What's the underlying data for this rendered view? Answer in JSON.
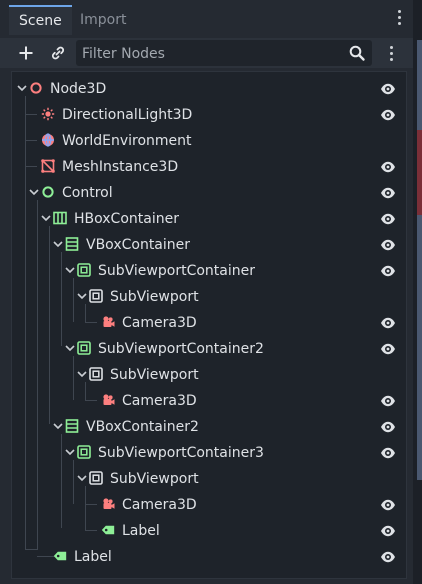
{
  "tabs": [
    {
      "label": "Scene",
      "active": true
    },
    {
      "label": "Import",
      "active": false
    }
  ],
  "toolbar": {
    "filter_placeholder": "Filter Nodes"
  },
  "colors": {
    "accent": "#6da5e8",
    "node3d": "#fc7f7f",
    "control": "#8eef97",
    "eye": "#dfe2e6"
  },
  "tree": [
    {
      "label": "Node3D",
      "icon": "node3d-circle-icon",
      "visible_toggle": true
    },
    {
      "label": "DirectionalLight3D",
      "icon": "directional-light-icon",
      "visible_toggle": true
    },
    {
      "label": "WorldEnvironment",
      "icon": "world-environment-icon",
      "visible_toggle": false
    },
    {
      "label": "MeshInstance3D",
      "icon": "mesh-instance-icon",
      "visible_toggle": true
    },
    {
      "label": "Control",
      "icon": "control-circle-icon",
      "visible_toggle": true
    },
    {
      "label": "HBoxContainer",
      "icon": "hbox-container-icon",
      "visible_toggle": true
    },
    {
      "label": "VBoxContainer",
      "icon": "vbox-container-icon",
      "visible_toggle": true
    },
    {
      "label": "SubViewportContainer",
      "icon": "subviewport-container-icon",
      "visible_toggle": true
    },
    {
      "label": "SubViewport",
      "icon": "subviewport-icon",
      "visible_toggle": false
    },
    {
      "label": "Camera3D",
      "icon": "camera-icon",
      "visible_toggle": true
    },
    {
      "label": "SubViewportContainer2",
      "icon": "subviewport-container-icon",
      "visible_toggle": true
    },
    {
      "label": "SubViewport",
      "icon": "subviewport-icon",
      "visible_toggle": false
    },
    {
      "label": "Camera3D",
      "icon": "camera-icon",
      "visible_toggle": true
    },
    {
      "label": "VBoxContainer2",
      "icon": "vbox-container-icon",
      "visible_toggle": true
    },
    {
      "label": "SubViewportContainer3",
      "icon": "subviewport-container-icon",
      "visible_toggle": true
    },
    {
      "label": "SubViewport",
      "icon": "subviewport-icon",
      "visible_toggle": false
    },
    {
      "label": "Camera3D",
      "icon": "camera-icon",
      "visible_toggle": true
    },
    {
      "label": "Label",
      "icon": "label-icon",
      "visible_toggle": true
    },
    {
      "label": "Label",
      "icon": "label-icon",
      "visible_toggle": true
    }
  ]
}
